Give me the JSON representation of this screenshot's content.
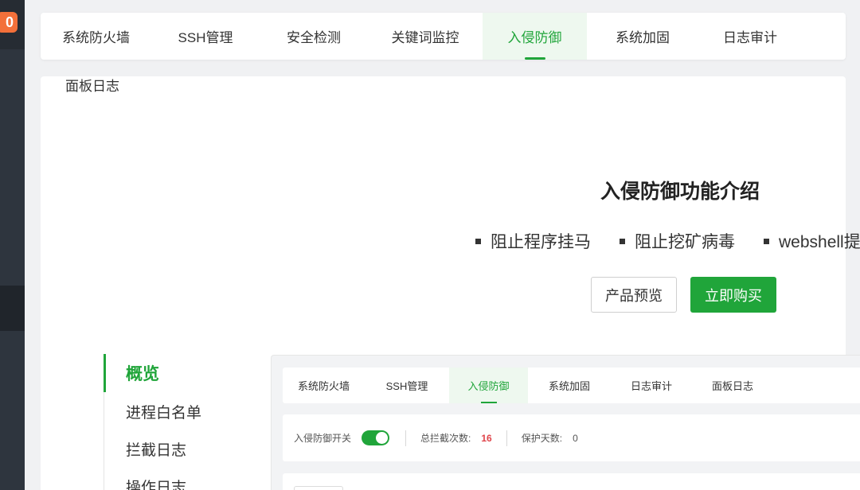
{
  "sidebar": {
    "badge_text": "0"
  },
  "top_tabs": [
    {
      "label": "系统防火墙",
      "active": false
    },
    {
      "label": "SSH管理",
      "active": false
    },
    {
      "label": "安全检测",
      "active": false
    },
    {
      "label": "关键词监控",
      "active": false
    },
    {
      "label": "入侵防御",
      "active": true
    },
    {
      "label": "系统加固",
      "active": false
    },
    {
      "label": "日志审计",
      "active": false
    }
  ],
  "main": {
    "panel_log_label": "面板日志",
    "intro_title": "入侵防御功能介绍",
    "features": [
      "阻止程序挂马",
      "阻止挖矿病毒",
      "webshell提"
    ],
    "preview_button": "产品预览",
    "buy_button": "立即购买"
  },
  "preview": {
    "menu": [
      {
        "label": "概览",
        "active": true
      },
      {
        "label": "进程白名单",
        "active": false
      },
      {
        "label": "拦截日志",
        "active": false
      },
      {
        "label": "操作日志",
        "active": false
      }
    ],
    "tabs": [
      {
        "label": "系统防火墙",
        "active": false
      },
      {
        "label": "SSH管理",
        "active": false
      },
      {
        "label": "入侵防御",
        "active": true
      },
      {
        "label": "系统加固",
        "active": false
      },
      {
        "label": "日志审计",
        "active": false
      },
      {
        "label": "面板日志",
        "active": false
      }
    ],
    "status": {
      "switch_label": "入侵防御开关",
      "switch_on": true,
      "total_blocked_label": "总拦截次数:",
      "total_blocked_value": "16",
      "protect_days_label": "保护天数:",
      "protect_days_value": "0"
    }
  },
  "colors": {
    "accent": "#20a53a",
    "danger": "#e0454b",
    "badge": "#f3703a",
    "sidebar": "#2e353e"
  }
}
